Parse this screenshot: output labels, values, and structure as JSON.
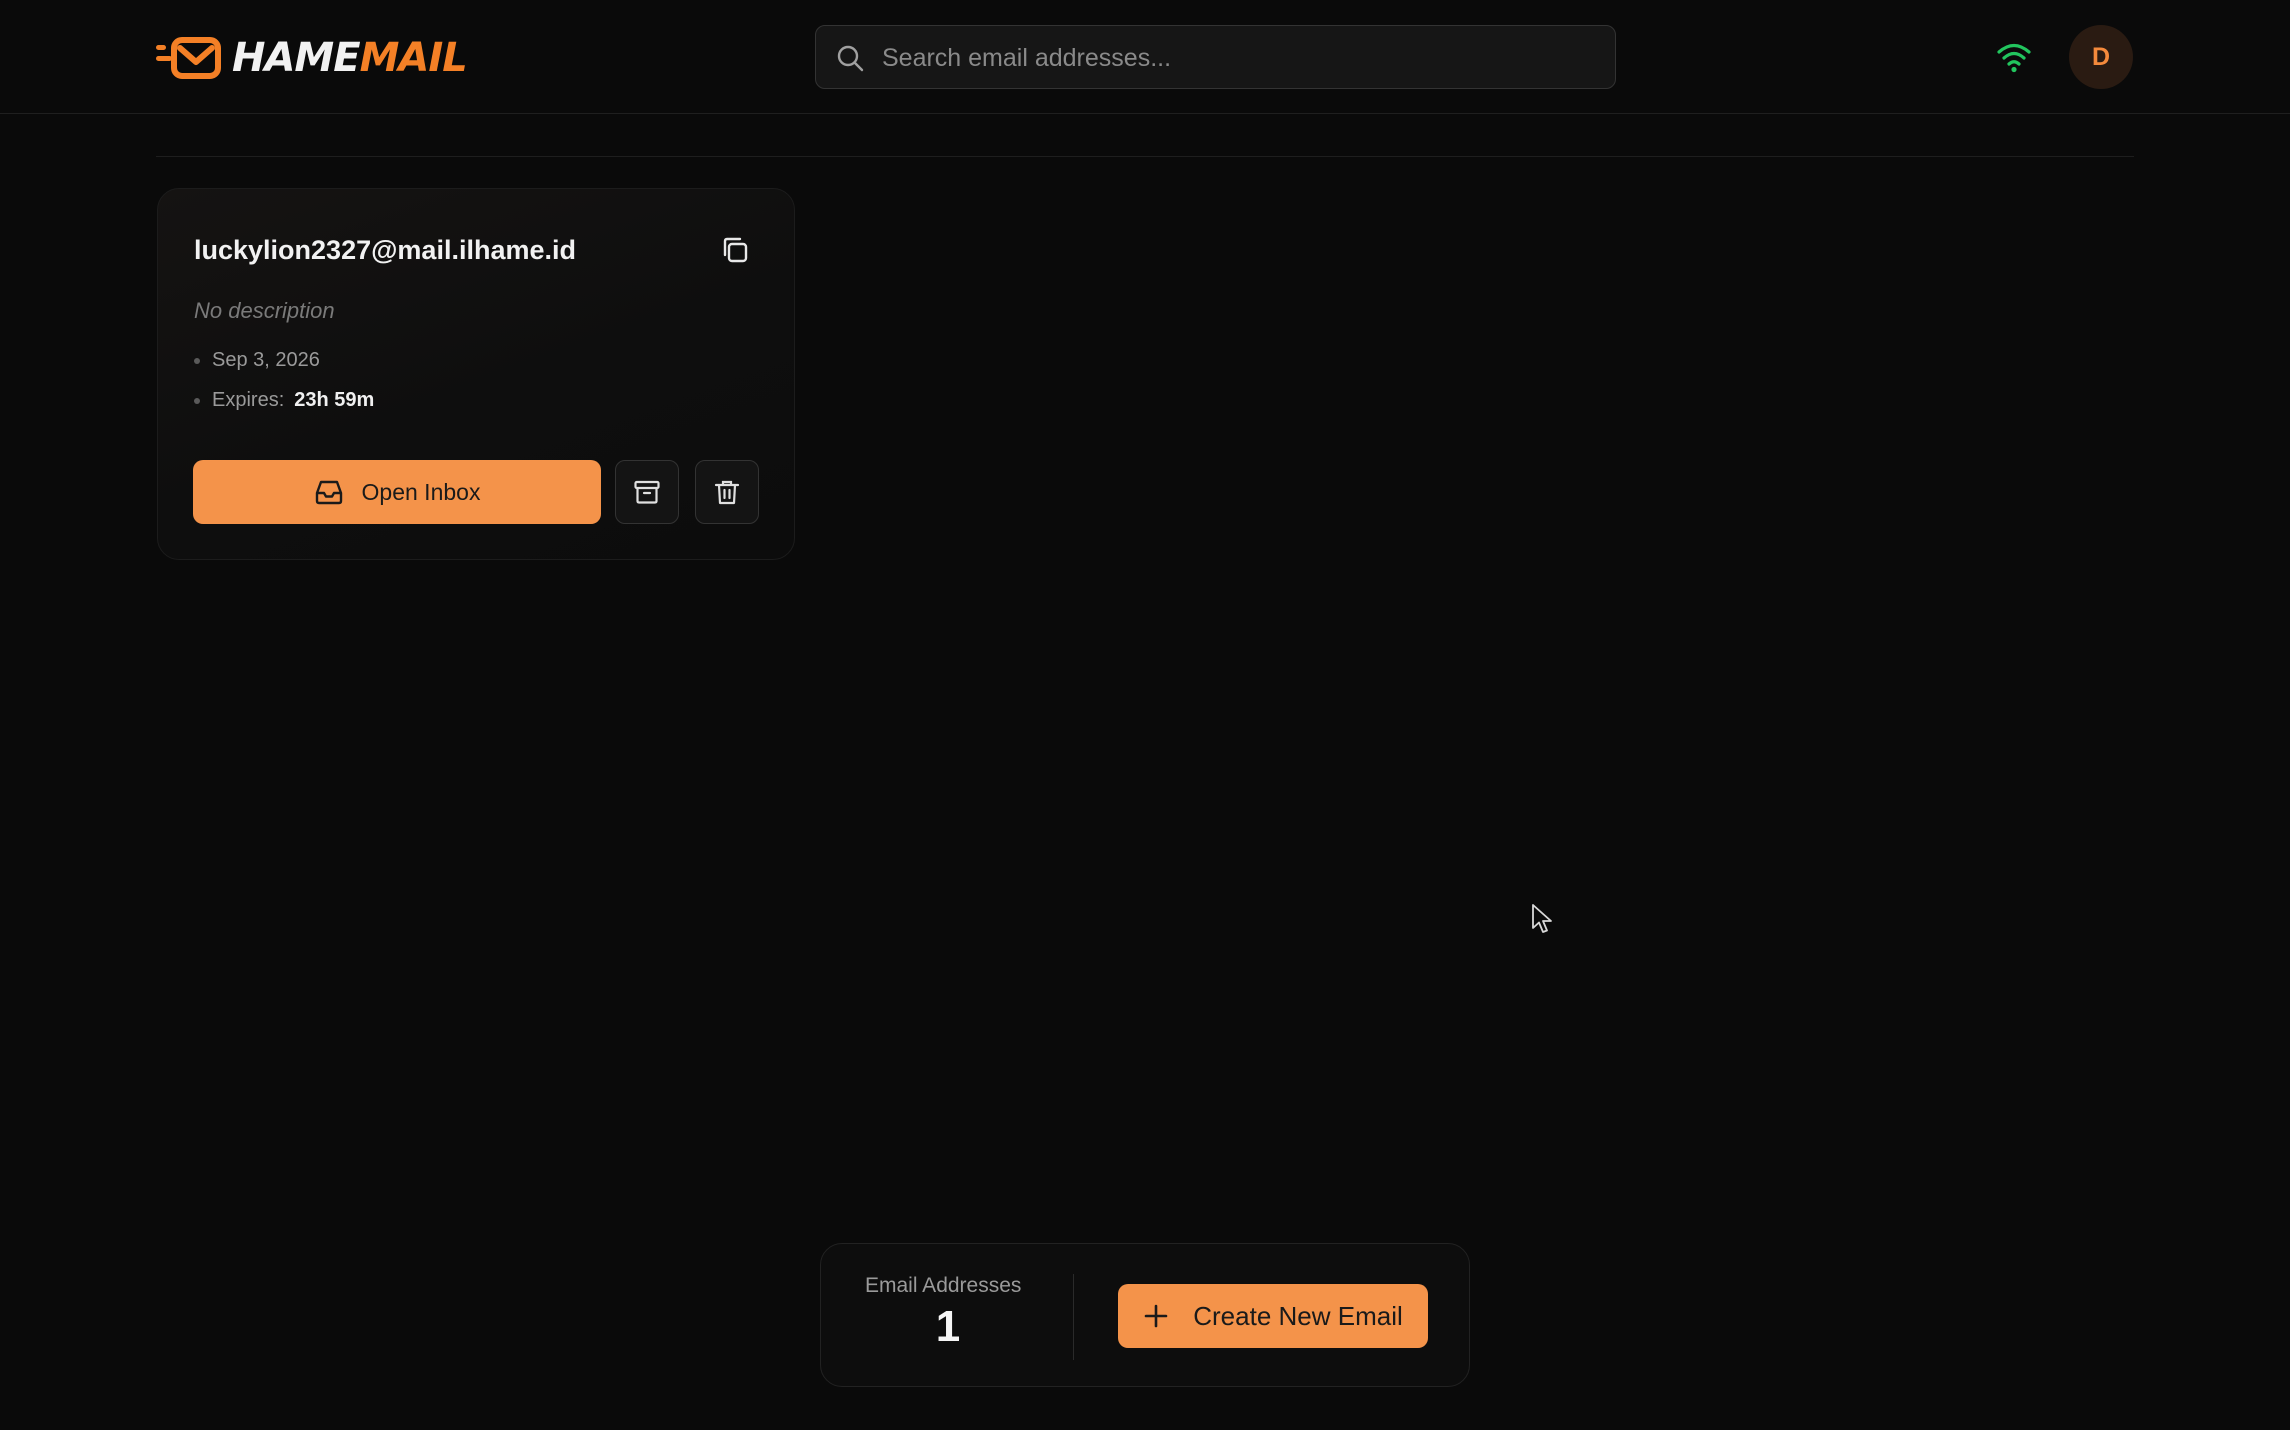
{
  "app": {
    "logo_text_a": "HAME",
    "logo_text_b": "MAIL",
    "brand_color": "#f48026",
    "accent_button_color": "#f4934a"
  },
  "header": {
    "search_placeholder": "Search email addresses...",
    "status_icon": "wifi-icon",
    "avatar_initial": "D"
  },
  "emails": [
    {
      "address": "luckylion2327@mail.ilhame.id",
      "description": "No description",
      "date": "Sep 3, 2026",
      "expires_label": "Expires:",
      "expires_value": "23h 59m",
      "open_label": "Open Inbox"
    }
  ],
  "footer": {
    "count_label": "Email Addresses",
    "count_value": "1",
    "create_label": "Create New Email"
  }
}
